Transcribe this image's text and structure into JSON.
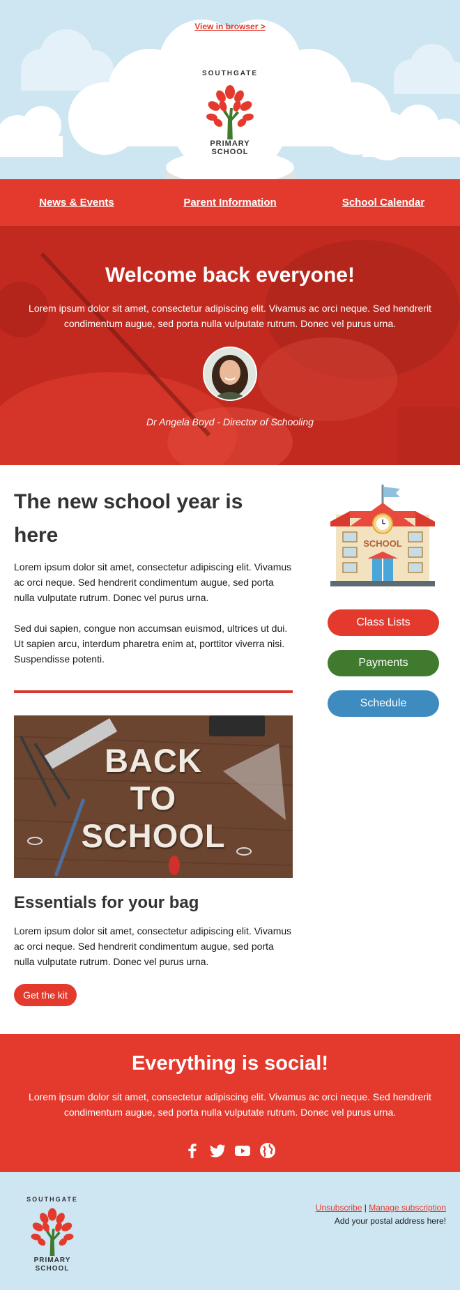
{
  "header": {
    "view_in_browser": "View in browser >",
    "logo_arc_text": "SOUTHGATE",
    "logo_line1": "PRIMARY",
    "logo_line2": "SCHOOL"
  },
  "nav": {
    "items": [
      "News & Events",
      "Parent Information",
      "School Calendar"
    ]
  },
  "hero": {
    "title": "Welcome back everyone!",
    "body": "Lorem ipsum dolor sit amet, consectetur adipiscing elit. Vivamus ac orci neque. Sed hendrerit condimentum augue, sed porta nulla vulputate rutrum. Donec vel purus urna.",
    "caption": "Dr Angela Boyd - Director of Schooling"
  },
  "main": {
    "title": "The new school year is here",
    "para1": "Lorem ipsum dolor sit amet, consectetur adipiscing elit. Vivamus ac orci neque. Sed hendrerit condimentum augue, sed porta nulla vulputate rutrum. Donec vel purus urna.",
    "para2": "Sed dui sapien, congue non accumsan euismod, ultrices ut dui. Ut sapien arcu, interdum pharetra enim at, porttitor viverra nisi. Suspendisse potenti.",
    "image_line1": "BACK",
    "image_line2": "TO",
    "image_line3": "SCHOOL",
    "subtitle": "Essentials for your bag",
    "para3": "Lorem ipsum dolor sit amet, consectetur adipiscing elit. Vivamus ac orci neque. Sed hendrerit condimentum augue, sed porta nulla vulputate rutrum. Donec vel purus urna.",
    "kit_button": "Get the kit"
  },
  "sidebar": {
    "school_sign": "SCHOOL",
    "buttons": [
      {
        "label": "Class Lists",
        "color": "#e43a2e"
      },
      {
        "label": "Payments",
        "color": "#3f7a2e"
      },
      {
        "label": "Schedule",
        "color": "#3d8bbf"
      }
    ]
  },
  "social": {
    "title": "Everything is social!",
    "body": "Lorem ipsum dolor sit amet, consectetur adipiscing elit. Vivamus ac orci neque. Sed hendrerit condimentum augue, sed porta nulla vulputate rutrum. Donec vel purus urna.",
    "icons": [
      "facebook-icon",
      "twitter-icon",
      "youtube-icon",
      "globe-icon"
    ]
  },
  "footer": {
    "unsubscribe": "Unsubscribe",
    "separator": "|",
    "manage": "Manage subscription",
    "address": "Add your postal address here!"
  },
  "colors": {
    "brand_red": "#e43a2e",
    "sky": "#cde6f2",
    "green": "#3f7a2e",
    "blue": "#3d8bbf"
  }
}
